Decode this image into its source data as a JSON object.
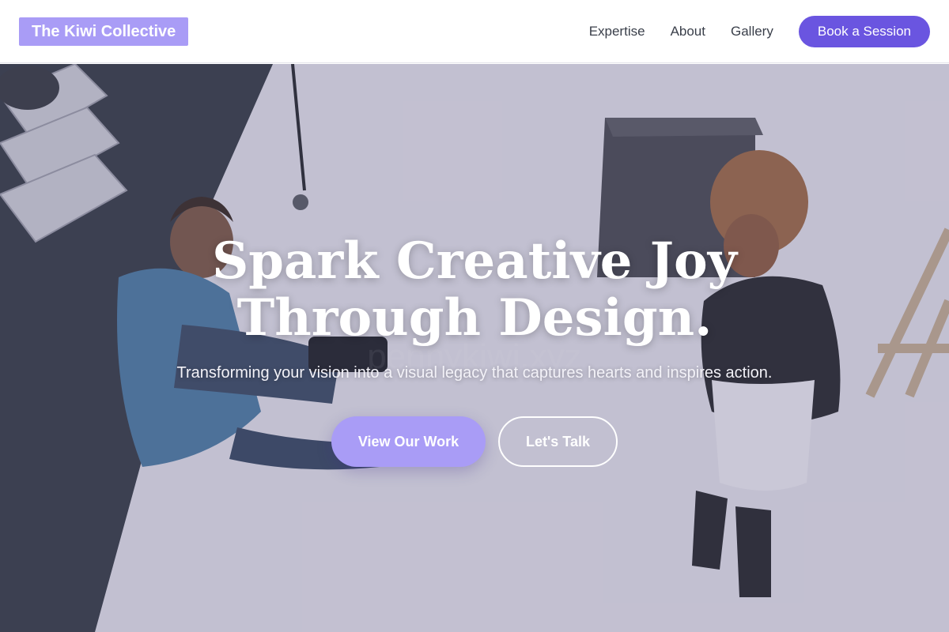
{
  "header": {
    "logo_text": "The Kiwi Collective",
    "nav": [
      {
        "label": "Expertise"
      },
      {
        "label": "About"
      },
      {
        "label": "Gallery"
      }
    ],
    "cta_label": "Book a Session"
  },
  "hero": {
    "title_line1": "Spark Creative Joy",
    "title_line2": "Through Design.",
    "subtitle": "Transforming your vision into a visual legacy that captures hearts and inspires action.",
    "primary_button": "View Our Work",
    "secondary_button": "Let's Talk",
    "background_image": "photographers-in-white-studio"
  },
  "colors": {
    "brand": "#a99cf6",
    "cta": "#6a55e0",
    "nav_text": "#3a3f4a"
  }
}
